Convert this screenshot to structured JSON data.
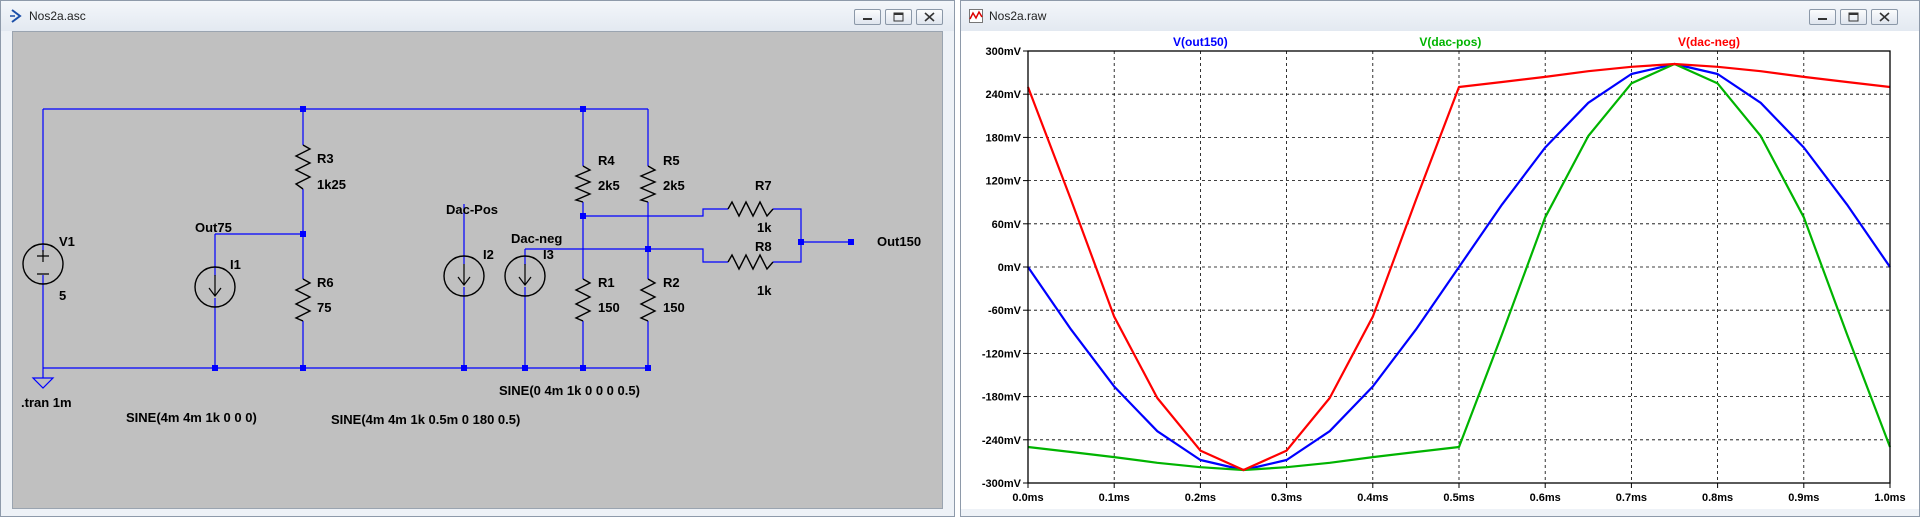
{
  "schematic_window": {
    "title": "Nos2a.asc",
    "labels": {
      "V1": "V1",
      "V1_value": "5",
      "I1": "I1",
      "I2": "I2",
      "I3": "I3",
      "R3": "R3",
      "R3_value": "1k25",
      "R6": "R6",
      "R6_value": "75",
      "R4": "R4",
      "R4_value": "2k5",
      "R5": "R5",
      "R5_value": "2k5",
      "R1": "R1",
      "R1_value": "150",
      "R2": "R2",
      "R2_value": "150",
      "R7": "R7",
      "R7_value": "1k",
      "R8": "R8",
      "R8_value": "1k",
      "net_out75": "Out75",
      "net_dacpos": "Dac-Pos",
      "net_dacneg": "Dac-neg",
      "net_out150": "Out150",
      "directive_tran": ".tran 1m",
      "source_i1": "SINE(4m 4m 1k 0 0 0)",
      "source_i3": "SINE(4m 4m 1k 0.5m 0 180 0.5)",
      "source_i2": "SINE(0 4m 1k 0 0 0 0.5)"
    },
    "colors": {
      "background": "#c0c0c0",
      "wire": "#0000ff",
      "junction": "#0000ff",
      "component": "#000000"
    }
  },
  "plot_window": {
    "title": "Nos2a.raw",
    "chart_data": {
      "type": "line",
      "title": "",
      "xlabel": "",
      "ylabel": "",
      "xlim": [
        0,
        1.0
      ],
      "ylim": [
        -300,
        300
      ],
      "x_unit": "ms",
      "y_unit": "mV",
      "x_tick_labels": [
        "0.0ms",
        "0.1ms",
        "0.2ms",
        "0.3ms",
        "0.4ms",
        "0.5ms",
        "0.6ms",
        "0.7ms",
        "0.8ms",
        "0.9ms",
        "1.0ms"
      ],
      "y_tick_labels": [
        "300mV",
        "240mV",
        "180mV",
        "120mV",
        "60mV",
        "0mV",
        "-60mV",
        "-120mV",
        "-180mV",
        "-240mV",
        "-300mV"
      ],
      "grid": true,
      "legend": "top",
      "series": [
        {
          "name": "V(out150)",
          "color": "#0000ff",
          "x": [
            0.0,
            0.05,
            0.1,
            0.15,
            0.2,
            0.25,
            0.3,
            0.35,
            0.4,
            0.45,
            0.5,
            0.55,
            0.6,
            0.65,
            0.7,
            0.75,
            0.8,
            0.85,
            0.9,
            0.95,
            1.0
          ],
          "y": [
            0,
            -87,
            -166,
            -228,
            -268,
            -282,
            -268,
            -228,
            -166,
            -87,
            0,
            87,
            166,
            228,
            268,
            282,
            268,
            228,
            166,
            87,
            0
          ]
        },
        {
          "name": "V(dac-pos)",
          "color": "#00b400",
          "x": [
            0.0,
            0.05,
            0.1,
            0.15,
            0.2,
            0.25,
            0.3,
            0.35,
            0.4,
            0.45,
            0.5,
            0.55,
            0.6,
            0.65,
            0.7,
            0.75,
            0.8,
            0.85,
            0.9,
            0.95,
            1.0
          ],
          "y": [
            -250,
            -257,
            -264,
            -272,
            -278,
            -282,
            -278,
            -272,
            -264,
            -257,
            -250,
            -93,
            69,
            182,
            255,
            282,
            255,
            182,
            69,
            -93,
            -250
          ]
        },
        {
          "name": "V(dac-neg)",
          "color": "#ff0000",
          "x": [
            0.0,
            0.05,
            0.1,
            0.15,
            0.2,
            0.25,
            0.3,
            0.35,
            0.4,
            0.45,
            0.5,
            0.55,
            0.6,
            0.65,
            0.7,
            0.75,
            0.8,
            0.85,
            0.9,
            0.95,
            1.0
          ],
          "y": [
            250,
            93,
            -69,
            -182,
            -255,
            -282,
            -255,
            -182,
            -69,
            93,
            250,
            257,
            264,
            272,
            278,
            282,
            278,
            272,
            264,
            257,
            250
          ]
        }
      ]
    }
  }
}
